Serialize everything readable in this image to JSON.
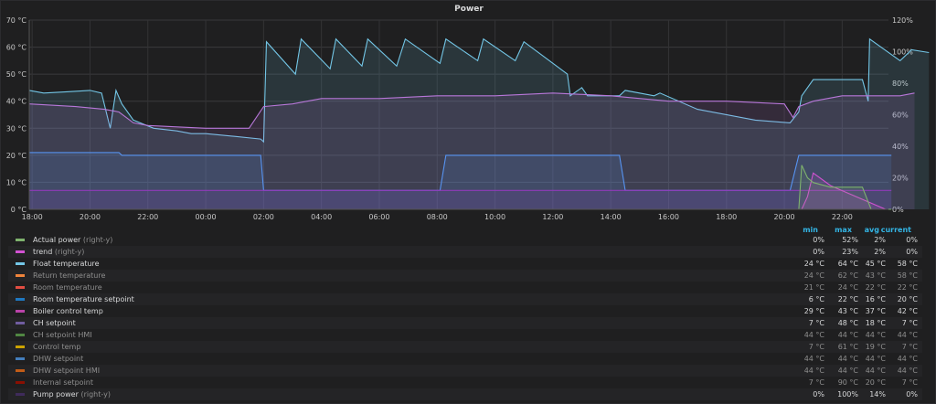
{
  "panel": {
    "title": "Power"
  },
  "chart_data": {
    "type": "area",
    "title": "Power",
    "x_ticks": [
      "18:00",
      "20:00",
      "22:00",
      "00:00",
      "02:00",
      "04:00",
      "06:00",
      "08:00",
      "10:00",
      "12:00",
      "14:00",
      "16:00",
      "18:00",
      "20:00",
      "22:00"
    ],
    "y_left": {
      "ticks": [
        "0 °C",
        "10 °C",
        "20 °C",
        "30 °C",
        "40 °C",
        "50 °C",
        "60 °C",
        "70 °C"
      ],
      "range": [
        0,
        70
      ],
      "unit": "°C"
    },
    "y_right": {
      "ticks": [
        "0%",
        "20%",
        "40%",
        "60%",
        "80%",
        "100%",
        "120%"
      ],
      "range": [
        0,
        120
      ],
      "unit": "%"
    },
    "grid": true,
    "x_hours": [
      17.9,
      47.6
    ],
    "series": [
      {
        "name": "Float temperature",
        "color": "#73c6e6",
        "axis": "left",
        "points": [
          [
            17.9,
            44
          ],
          [
            18.4,
            43
          ],
          [
            19.2,
            43.5
          ],
          [
            20.0,
            44
          ],
          [
            20.4,
            43
          ],
          [
            20.7,
            30
          ],
          [
            20.9,
            44
          ],
          [
            21.1,
            39
          ],
          [
            21.5,
            33
          ],
          [
            22.2,
            30
          ],
          [
            23.0,
            29
          ],
          [
            23.5,
            28
          ],
          [
            24.0,
            28
          ],
          [
            25.0,
            27
          ],
          [
            25.9,
            26
          ],
          [
            26.0,
            25
          ],
          [
            26.1,
            62
          ],
          [
            27.1,
            50
          ],
          [
            27.3,
            63
          ],
          [
            28.3,
            52
          ],
          [
            28.5,
            63
          ],
          [
            29.4,
            53
          ],
          [
            29.6,
            63
          ],
          [
            30.6,
            53
          ],
          [
            30.9,
            63
          ],
          [
            32.1,
            54
          ],
          [
            32.3,
            63
          ],
          [
            33.4,
            55
          ],
          [
            33.6,
            63
          ],
          [
            34.7,
            55
          ],
          [
            35.0,
            62
          ],
          [
            36.5,
            50
          ],
          [
            36.6,
            42
          ],
          [
            37.0,
            45
          ],
          [
            37.2,
            42
          ],
          [
            38.3,
            42
          ],
          [
            38.5,
            44
          ],
          [
            39.5,
            42
          ],
          [
            39.7,
            43
          ],
          [
            41.0,
            37
          ],
          [
            43.0,
            33
          ],
          [
            44.2,
            32
          ],
          [
            44.5,
            36
          ],
          [
            44.6,
            42
          ],
          [
            45.0,
            48
          ],
          [
            46.7,
            48
          ],
          [
            46.9,
            40
          ],
          [
            46.95,
            63
          ],
          [
            48.0,
            55
          ],
          [
            48.4,
            59
          ],
          [
            49.0,
            58
          ]
        ]
      },
      {
        "name": "Boiler control temp",
        "color": "#b877d9",
        "axis": "left",
        "points": [
          [
            17.9,
            39
          ],
          [
            19.5,
            38
          ],
          [
            20.5,
            37
          ],
          [
            21.0,
            36
          ],
          [
            21.5,
            32
          ],
          [
            22.0,
            31
          ],
          [
            24.0,
            30
          ],
          [
            25.5,
            30
          ],
          [
            26.0,
            38
          ],
          [
            27.0,
            39
          ],
          [
            28.0,
            41
          ],
          [
            30.0,
            41
          ],
          [
            32.0,
            42
          ],
          [
            34.0,
            42
          ],
          [
            36.0,
            43
          ],
          [
            38.0,
            42
          ],
          [
            40.0,
            40
          ],
          [
            42.0,
            40
          ],
          [
            44.0,
            39
          ],
          [
            44.3,
            34
          ],
          [
            44.5,
            38
          ],
          [
            45.0,
            40
          ],
          [
            46.0,
            42
          ],
          [
            47.0,
            42
          ],
          [
            48.0,
            42
          ],
          [
            48.5,
            43
          ]
        ]
      },
      {
        "name": "Room temperature setpoint",
        "color": "#5794f2",
        "axis": "left",
        "points": [
          [
            17.9,
            21
          ],
          [
            21.0,
            21
          ],
          [
            21.1,
            20
          ],
          [
            25.9,
            20
          ],
          [
            26.0,
            7
          ],
          [
            32.1,
            7
          ],
          [
            32.3,
            20
          ],
          [
            38.3,
            20
          ],
          [
            38.5,
            7
          ],
          [
            44.2,
            7
          ],
          [
            44.5,
            20
          ],
          [
            47.7,
            20
          ]
        ]
      },
      {
        "name": "CH setpoint",
        "color": "#8f3bb8",
        "axis": "left",
        "points": [
          [
            17.9,
            7
          ],
          [
            47.7,
            7
          ]
        ]
      },
      {
        "name": "trend",
        "color": "#d252d2",
        "axis": "right",
        "points": [
          [
            17.9,
            0
          ],
          [
            44.6,
            0
          ],
          [
            44.8,
            8
          ],
          [
            45.0,
            23
          ],
          [
            45.6,
            15
          ],
          [
            47.5,
            0
          ]
        ]
      },
      {
        "name": "Actual power",
        "color": "#7eb26d",
        "axis": "right",
        "points": [
          [
            17.9,
            0
          ],
          [
            44.5,
            0
          ],
          [
            44.6,
            28
          ],
          [
            44.8,
            20
          ],
          [
            45.0,
            17
          ],
          [
            45.6,
            14
          ],
          [
            46.7,
            14
          ],
          [
            47.0,
            0
          ],
          [
            47.7,
            0
          ]
        ]
      }
    ]
  },
  "legend": {
    "headers": {
      "min": "min",
      "max": "max",
      "avg": "avg",
      "current": "current"
    },
    "rows": [
      {
        "name": "Actual power",
        "suffix": " (right-y)",
        "color": "#7eb26d",
        "active": true,
        "min": "0%",
        "max": "52%",
        "avg": "2%",
        "current": "0%"
      },
      {
        "name": "trend",
        "suffix": " (right-y)",
        "color": "#d252d2",
        "active": true,
        "min": "0%",
        "max": "23%",
        "avg": "2%",
        "current": "0%"
      },
      {
        "name": "Float temperature",
        "suffix": "",
        "color": "#73c6e6",
        "active": true,
        "min": "24 °C",
        "max": "64 °C",
        "avg": "45 °C",
        "current": "58 °C"
      },
      {
        "name": "Return temperature",
        "suffix": "",
        "color": "#ef843c",
        "active": false,
        "min": "24 °C",
        "max": "62 °C",
        "avg": "43 °C",
        "current": "58 °C"
      },
      {
        "name": "Room temperature",
        "suffix": "",
        "color": "#e24d42",
        "active": false,
        "min": "21 °C",
        "max": "24 °C",
        "avg": "22 °C",
        "current": "22 °C"
      },
      {
        "name": "Room temperature setpoint",
        "suffix": "",
        "color": "#1f78c1",
        "active": true,
        "min": "6 °C",
        "max": "22 °C",
        "avg": "16 °C",
        "current": "20 °C"
      },
      {
        "name": "Boiler control temp",
        "suffix": "",
        "color": "#ba43a9",
        "active": true,
        "min": "29 °C",
        "max": "43 °C",
        "avg": "37 °C",
        "current": "42 °C"
      },
      {
        "name": "CH setpoint",
        "suffix": "",
        "color": "#705da0",
        "active": true,
        "min": "7 °C",
        "max": "48 °C",
        "avg": "18 °C",
        "current": "7 °C"
      },
      {
        "name": "CH setpoint HMI",
        "suffix": "",
        "color": "#508642",
        "active": false,
        "min": "44 °C",
        "max": "44 °C",
        "avg": "44 °C",
        "current": "44 °C"
      },
      {
        "name": "Control temp",
        "suffix": "",
        "color": "#cca300",
        "active": false,
        "min": "7 °C",
        "max": "61 °C",
        "avg": "19 °C",
        "current": "7 °C"
      },
      {
        "name": "DHW setpoint",
        "suffix": "",
        "color": "#447ebc",
        "active": false,
        "min": "44 °C",
        "max": "44 °C",
        "avg": "44 °C",
        "current": "44 °C"
      },
      {
        "name": "DHW setpoint HMI",
        "suffix": "",
        "color": "#c15c17",
        "active": false,
        "min": "44 °C",
        "max": "44 °C",
        "avg": "44 °C",
        "current": "44 °C"
      },
      {
        "name": "Internal setpoint",
        "suffix": "",
        "color": "#890f02",
        "active": false,
        "min": "7 °C",
        "max": "90 °C",
        "avg": "20 °C",
        "current": "7 °C"
      },
      {
        "name": "Pump power",
        "suffix": " (right-y)",
        "color": "#3f2b5b",
        "active": true,
        "min": "0%",
        "max": "100%",
        "avg": "14%",
        "current": "0%"
      }
    ]
  }
}
